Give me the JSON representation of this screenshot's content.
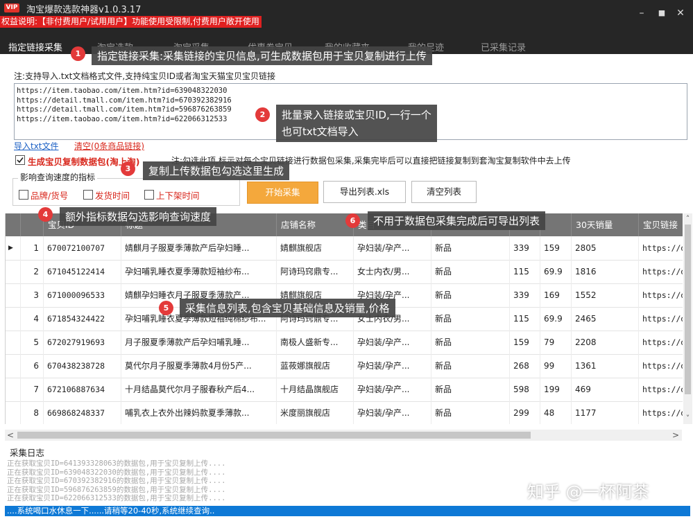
{
  "window": {
    "title": "淘宝爆款选款神器v1.0.3.17",
    "vip_badge": "VIP",
    "rights_notice": "权益说明:【非付费用户/试用用户】功能使用受限制,付费用户敞开使用",
    "minimize": "–",
    "maximize": "■",
    "close": "✕"
  },
  "tabs": [
    {
      "label": "指定链接采集",
      "active": true
    },
    {
      "label": "淘宝选款",
      "active": false
    },
    {
      "label": "淘宝采集",
      "active": false
    },
    {
      "label": "优惠券宝贝",
      "active": false
    },
    {
      "label": "我的收藏夹",
      "active": false
    },
    {
      "label": "我的足迹",
      "active": false
    },
    {
      "label": "已采集记录",
      "active": false
    }
  ],
  "annotations": [
    {
      "num": "1",
      "text": "指定链接采集:采集链接的宝贝信息,可生成数据包用于宝贝复制进行上传"
    },
    {
      "num": "2",
      "text": "批量录入链接或宝贝ID,一行一个",
      "text2": "也可txt文档导入"
    },
    {
      "num": "3",
      "text": "复制上传数据包勾选这里生成"
    },
    {
      "num": "4",
      "text": "额外指标数据勾选影响查询速度"
    },
    {
      "num": "5",
      "text": "采集信息列表,包含宝贝基础信息及销量,价格"
    },
    {
      "num": "6",
      "text": "不用于数据包采集完成后可导出列表"
    }
  ],
  "input_section": {
    "note": "注:支持导入.txt文档格式文件,支持纯宝贝ID或者淘宝天猫宝贝宝贝链接",
    "links": [
      "https://item.taobao.com/item.htm?id=639048322030",
      "https://detail.tmall.com/item.htm?id=670392382916",
      "https://detail.tmall.com/item.htm?id=596876263859",
      "https://item.taobao.com/item.htm?id=622066312533"
    ],
    "import_link": "导入txt文件",
    "clear_link": "清空(0条商品链接)"
  },
  "options": {
    "generate_label": "生成宝贝复制数据包(淘上淘)",
    "generate_desc": "注:勾选此项,标示对每个宝贝链接进行数据包采集,采集完毕后可以直接把链接复制到套淘宝复制软件中去上传",
    "speed_group_title": "影响查询速度的指标",
    "speed_options": [
      "品牌/货号",
      "发货时间",
      "上下架时间"
    ]
  },
  "buttons": {
    "start": "开始采集",
    "export": "导出列表.xls",
    "clear_list": "清空列表"
  },
  "table": {
    "columns": [
      "",
      "",
      "宝贝ID",
      "标题",
      "店铺名称",
      "类目",
      "",
      "",
      "",
      "30天销量",
      "宝贝链接"
    ],
    "rows": [
      [
        "▶",
        "1",
        "670072100707",
        "婧麒月子服夏季薄款产后孕妇睡...",
        "婧麒旗舰店",
        "孕妇装/孕产...",
        "新品",
        "339",
        "159",
        "2805",
        "https://d"
      ],
      [
        "",
        "2",
        "671045122414",
        "孕妇哺乳睡衣夏季薄款短袖纱布...",
        "阿诗玛窍鼎专...",
        "女士内衣/男...",
        "新品",
        "115",
        "69.9",
        "1816",
        "https://d"
      ],
      [
        "",
        "3",
        "671000096533",
        "婧麒孕妇睡衣月子服夏季薄款产...",
        "婧麒旗舰店",
        "孕妇装/孕产...",
        "新品",
        "339",
        "169",
        "1552",
        "https://d"
      ],
      [
        "",
        "4",
        "671854324422",
        "孕妇哺乳睡衣夏季薄款短袖纯棉纱布...",
        "阿诗玛窍鼎专...",
        "女士内衣/男...",
        "新品",
        "115",
        "69.9",
        "2465",
        "https://d"
      ],
      [
        "",
        "5",
        "672027919693",
        "月子服夏季薄款产后孕妇哺乳睡...",
        "南极人盛新专...",
        "孕妇装/孕产...",
        "新品",
        "159",
        "79",
        "2208",
        "https://d"
      ],
      [
        "",
        "6",
        "670438238728",
        "莫代尔月子服夏季薄款4月份5产...",
        "蓝莜娜旗舰店",
        "孕妇装/孕产...",
        "新品",
        "268",
        "99",
        "1361",
        "https://d"
      ],
      [
        "",
        "7",
        "672106887634",
        "十月结晶莫代尔月子服春秋产后4...",
        "十月结晶旗舰店",
        "孕妇装/孕产...",
        "新品",
        "598",
        "199",
        "469",
        "https://d"
      ],
      [
        "",
        "8",
        "669868248337",
        "哺乳衣上衣外出辣妈款夏季薄款...",
        "米度丽旗舰店",
        "孕妇装/孕产...",
        "新品",
        "299",
        "48",
        "1177",
        "https://d"
      ]
    ]
  },
  "scroll": {
    "up": "˄",
    "down": "˅",
    "left": "<",
    "right": ">"
  },
  "log": {
    "title": "采集日志",
    "lines": [
      "正在获取宝贝ID=641393328063的数据包,用于宝贝复制上传....",
      "正在获取宝贝ID=639048322030的数据包,用于宝贝复制上传....",
      "正在获取宝贝ID=670392382916的数据包,用于宝贝复制上传....",
      "正在获取宝贝ID=596876263859的数据包,用于宝贝复制上传....",
      "正在获取宝贝ID=622066312533的数据包,用于宝贝复制上传...."
    ],
    "status": "....系统喝口水休息一下......请稍等20-40秒,系统继续查询.."
  },
  "watermark": "知乎 @一杯阿茶",
  "colors": {
    "titlebar": "#262626",
    "accent_red": "#e02020",
    "start_button": "#f4a83c",
    "table_header": "#757575",
    "status_bar": "#0e79d6",
    "callout": "#444444"
  }
}
